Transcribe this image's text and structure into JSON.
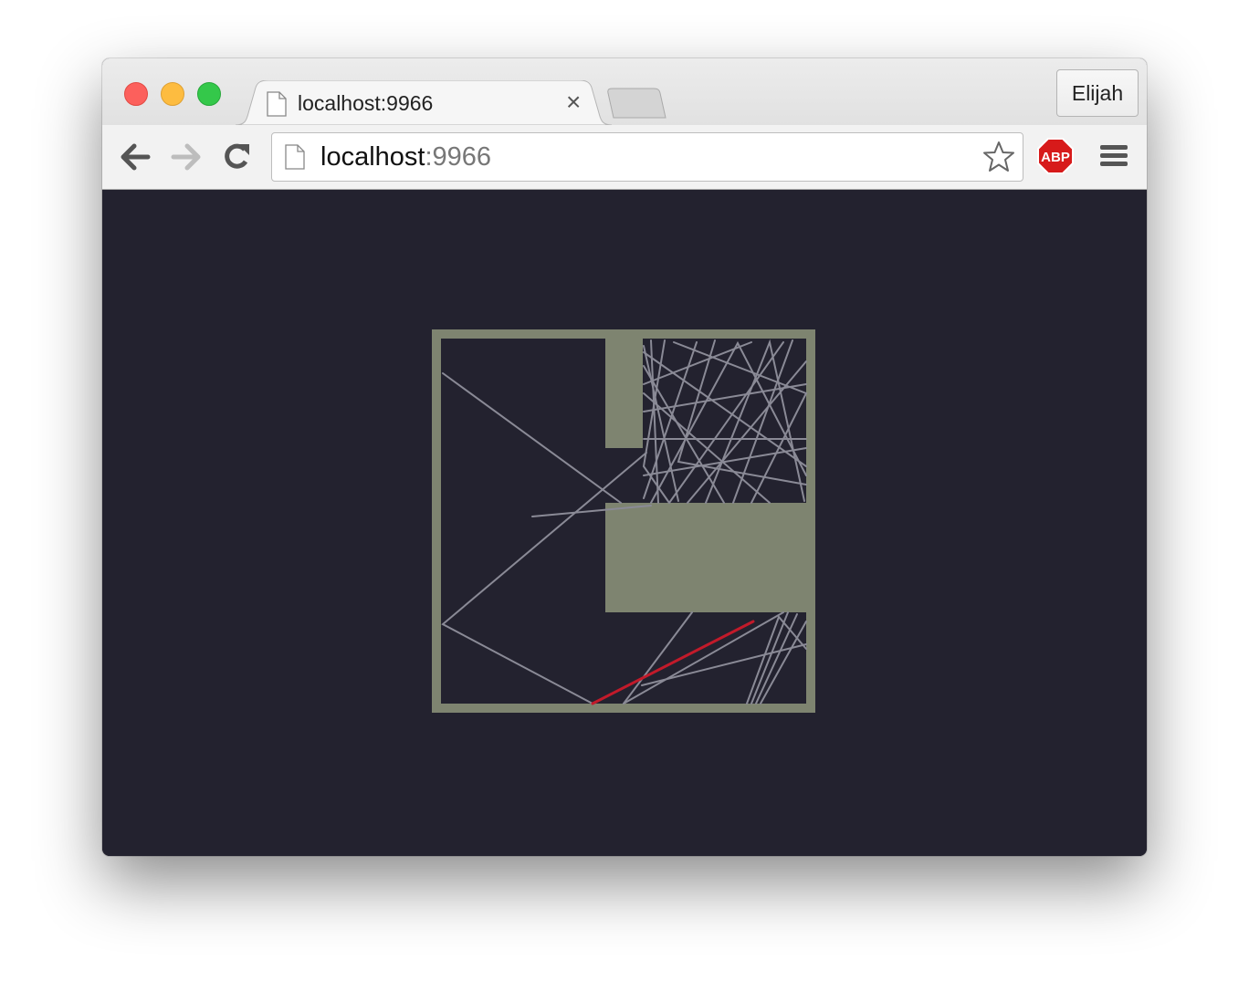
{
  "window": {
    "tab": {
      "title": "localhost:9966",
      "close_glyph": "×"
    },
    "profile": {
      "label": "Elijah"
    }
  },
  "toolbar": {
    "url_host": "localhost",
    "url_port": ":9966",
    "extension": {
      "label": "ABP"
    }
  },
  "colors": {
    "background": "#23222f",
    "wall": "#7e8470",
    "ray": "#8a8a96",
    "active_ray": "#c21a2a"
  },
  "icons": {
    "back": "arrow-left-icon",
    "forward": "arrow-right-icon",
    "reload": "reload-icon",
    "bookmark": "star-icon",
    "menu": "hamburger-menu-icon",
    "page": "page-icon"
  }
}
